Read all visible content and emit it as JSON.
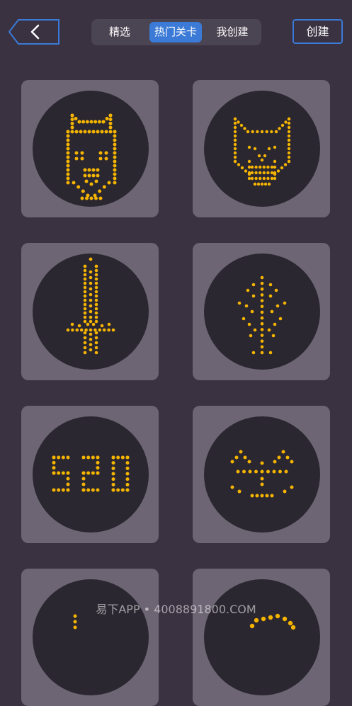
{
  "header": {
    "tabs": [
      {
        "label": "精选",
        "active": false
      },
      {
        "label": "热门关卡",
        "active": true
      },
      {
        "label": "我创建",
        "active": false
      }
    ],
    "create_label": "创建"
  },
  "levels": [
    {
      "name": "dog"
    },
    {
      "name": "cat"
    },
    {
      "name": "sword"
    },
    {
      "name": "tree"
    },
    {
      "name": "520"
    },
    {
      "name": "face"
    },
    {
      "name": "partial-1"
    },
    {
      "name": "partial-2"
    }
  ],
  "watermark": "易下APP • 4008891800.COM",
  "colors": {
    "background": "#3a3141",
    "card": "#6d6574",
    "circle": "#2a2730",
    "dot": "#f5b400",
    "accent": "#3b7ad6"
  },
  "icons": {
    "back": "chevron-left-icon"
  }
}
